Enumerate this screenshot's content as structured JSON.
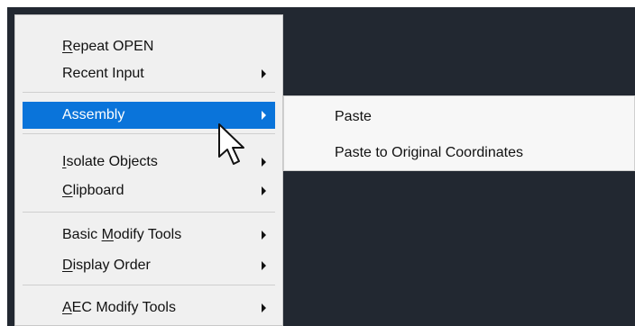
{
  "context_menu": {
    "items": [
      {
        "id": "repeat",
        "mnemonic": "R",
        "rest": "epeat OPEN",
        "has_submenu": false
      },
      {
        "id": "recent",
        "mnemonic": "",
        "rest": "Recent Input",
        "has_submenu": true
      },
      {
        "id": "assembly",
        "mnemonic": "",
        "rest": "Assembly",
        "has_submenu": true,
        "active": true
      },
      {
        "id": "isolate",
        "mnemonic": "I",
        "rest": "solate Objects",
        "has_submenu": true
      },
      {
        "id": "clipboard",
        "mnemonic": "C",
        "rest": "lipboard",
        "has_submenu": true
      },
      {
        "id": "basic",
        "pre": "Basic ",
        "mnemonic": "M",
        "rest": "odify Tools",
        "has_submenu": true
      },
      {
        "id": "display",
        "mnemonic": "D",
        "rest": "isplay Order",
        "has_submenu": true
      },
      {
        "id": "aec",
        "mnemonic": "A",
        "rest": "EC Modify Tools",
        "has_submenu": true
      }
    ]
  },
  "submenu": {
    "items": [
      {
        "label": "Paste"
      },
      {
        "label": "Paste to Original Coordinates"
      }
    ]
  },
  "colors": {
    "canvas": "#222831",
    "menu_bg": "#f0f0f0",
    "highlight": "#0a74da"
  },
  "icons": {
    "cursor": "mouse-pointer-icon",
    "submenu_arrow": "chevron-right-icon"
  }
}
